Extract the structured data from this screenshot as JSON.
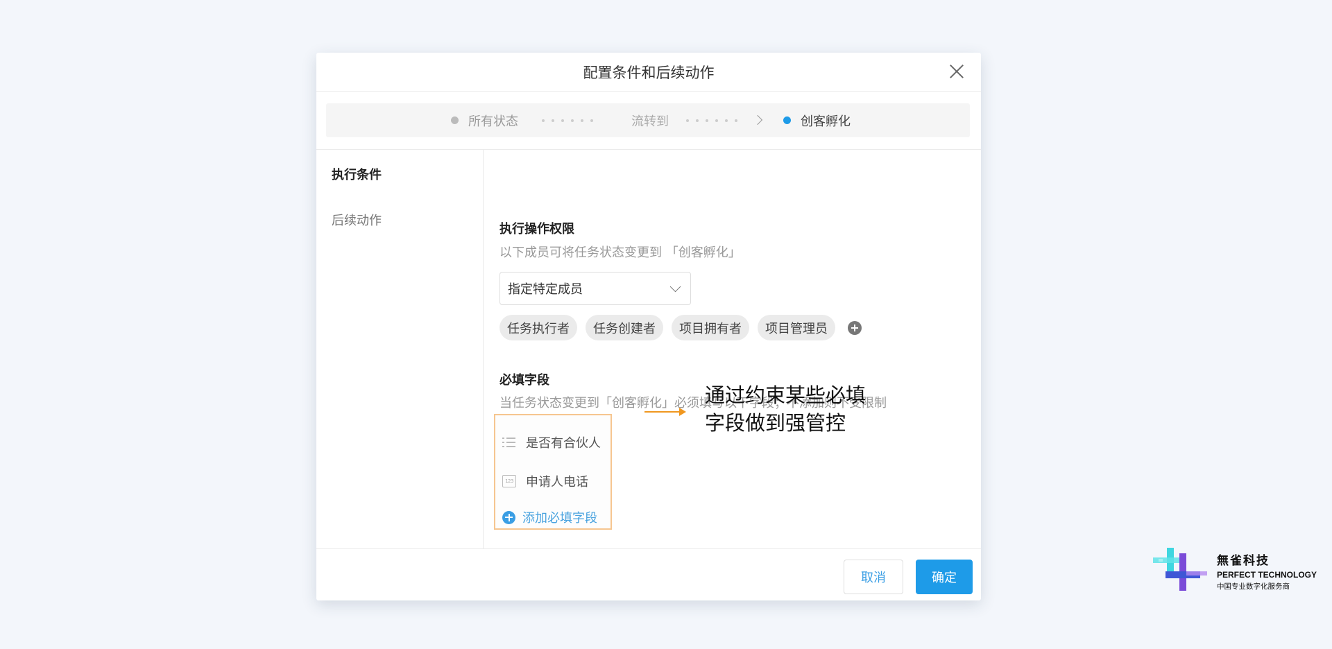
{
  "modal": {
    "title": "配置条件和后续动作",
    "steps": [
      {
        "label": "所有状态"
      },
      {
        "label": "流转到"
      },
      {
        "label": "创客孵化"
      }
    ],
    "sidebar": {
      "items": [
        {
          "label": "执行条件"
        },
        {
          "label": "后续动作"
        }
      ]
    },
    "permission": {
      "title": "执行操作权限",
      "description": "以下成员可将任务状态变更到 「创客孵化」",
      "select_value": "指定特定成员",
      "tags": [
        "任务执行者",
        "任务创建者",
        "项目拥有者",
        "项目管理员"
      ]
    },
    "required_fields": {
      "title": "必填字段",
      "description": "当任务状态变更到「创客孵化」必须填写以下字段；不添加则不受限制",
      "fields": [
        {
          "label": "是否有合伙人",
          "icon": "list-icon"
        },
        {
          "label": "申请人电话",
          "icon": "number-field-icon",
          "icon_text": "123"
        }
      ],
      "add_label": "添加必填字段"
    },
    "annotation": {
      "line1": "通过约束某些必填",
      "line2": "字段做到强管控"
    },
    "footer": {
      "cancel_label": "取消",
      "ok_label": "确定"
    }
  },
  "brand": {
    "name_cn": "無雀科技",
    "name_en": "PERFECT TECHNOLOGY",
    "slogan": "中国专业数字化服务商"
  },
  "colors": {
    "accent": "#1e9be8",
    "highlight_border": "#f6c690",
    "arrow": "#f0971f",
    "background": "#f3f6fb"
  }
}
